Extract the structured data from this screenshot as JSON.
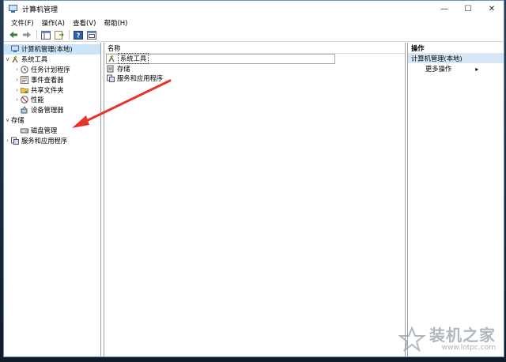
{
  "window": {
    "title": "计算机管理",
    "controls": {
      "minimize": "—",
      "maximize": "☐",
      "close": "✕"
    }
  },
  "menu": [
    "文件(F)",
    "操作(A)",
    "查看(V)",
    "帮助(H)"
  ],
  "tree": {
    "root": "计算机管理(本地)",
    "system_tools": "系统工具",
    "task_scheduler": "任务计划程序",
    "event_viewer": "事件查看器",
    "shared_folders": "共享文件夹",
    "performance": "性能",
    "device_manager": "设备管理器",
    "storage": "存储",
    "disk_management": "磁盘管理",
    "services_apps": "服务和应用程序"
  },
  "list": {
    "column_name": "名称",
    "items": [
      "系统工具",
      "存储",
      "服务和应用程序"
    ]
  },
  "actions": {
    "header": "操作",
    "section": "计算机管理(本地)",
    "more": "更多操作"
  },
  "watermark": {
    "title": "装机之家",
    "url": "www.lotpc.com"
  },
  "colors": {
    "selection": "#cce4f7",
    "arrow": "#e8332a",
    "section_bg": "#d6e6f5"
  }
}
